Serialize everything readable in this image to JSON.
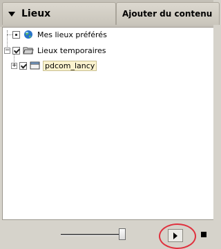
{
  "header": {
    "places_tab": "Lieux",
    "add_content_tab": "Ajouter du contenu"
  },
  "tree": {
    "items": [
      {
        "label": "Mes lieux préférés",
        "checked": "partial",
        "icon": "globe-icon"
      },
      {
        "label": "Lieux temporaires",
        "checked": true,
        "icon": "folder-open-icon",
        "expanded": true
      },
      {
        "label": "pdcom_lancy",
        "checked": true,
        "icon": "layer-icon",
        "expanded": false,
        "selected": true
      }
    ]
  },
  "toolbar": {
    "slider_value": 0.95,
    "play_icon": "play-icon",
    "stop_icon": "stop-icon"
  },
  "colors": {
    "highlight": "#e0303d",
    "selection_bg": "#fbf3cf"
  }
}
